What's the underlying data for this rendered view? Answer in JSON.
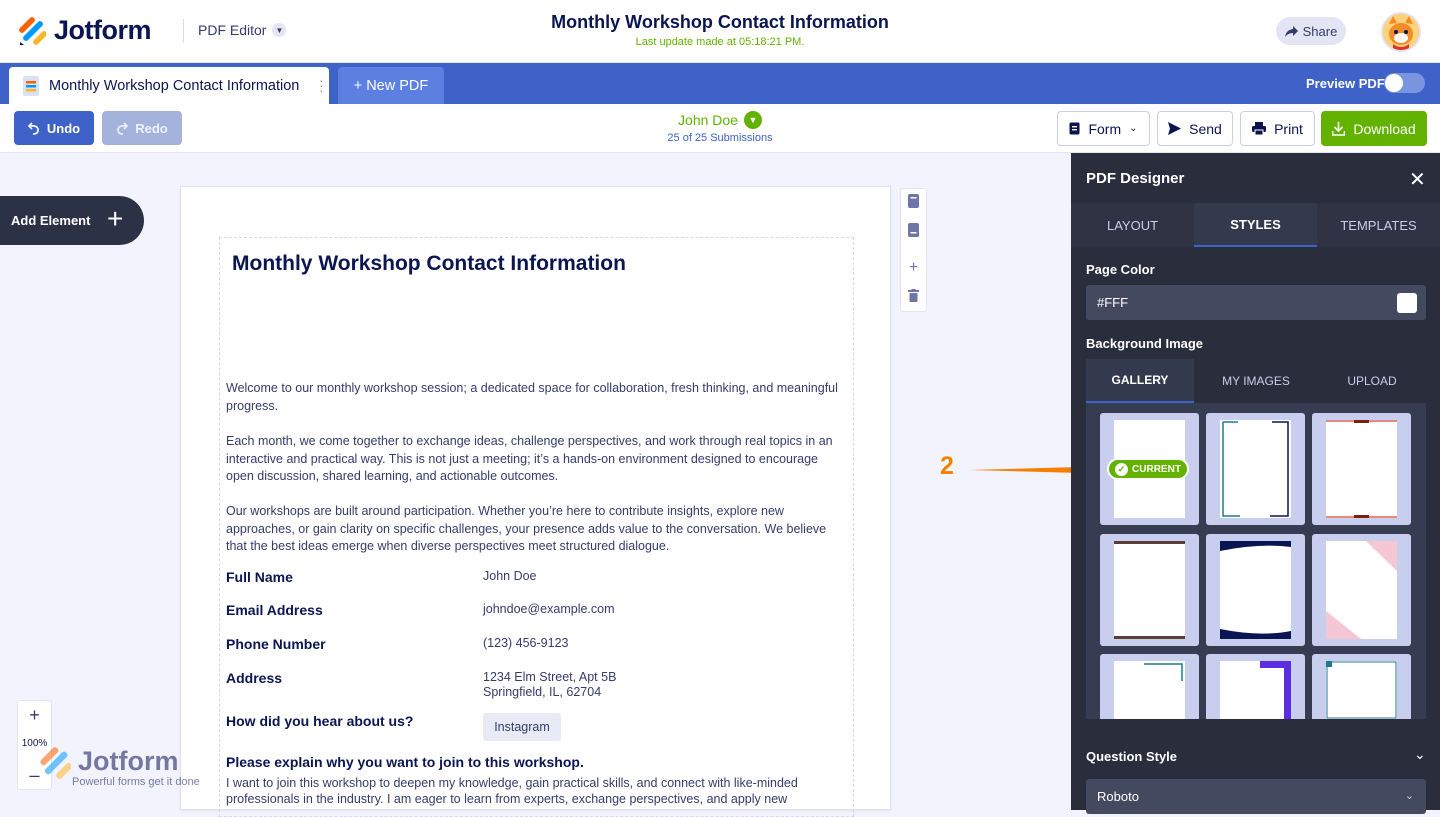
{
  "header": {
    "brand": "Jotform",
    "editor_label": "PDF Editor",
    "title": "Monthly Workshop Contact Information",
    "last_update": "Last update made at 05:18:21 PM.",
    "share_label": "Share"
  },
  "tabs": {
    "active_tab": "Monthly Workshop Contact Information",
    "new_pdf": "+ New PDF",
    "preview_label": "Preview PDF",
    "preview_on": false
  },
  "toolbar": {
    "undo": "Undo",
    "redo": "Redo",
    "submitter": "John Doe",
    "submissions": "25 of 25 Submissions",
    "form": "Form",
    "send": "Send",
    "print": "Print",
    "download": "Download"
  },
  "left": {
    "add_element": "Add Element",
    "zoom": "100%",
    "watermark_brand": "Jotform",
    "watermark_tagline": "Powerful forms get it done"
  },
  "document": {
    "title": "Monthly Workshop Contact Information",
    "paragraphs": [
      "Welcome to our monthly workshop session; a dedicated space for collaboration, fresh thinking, and meaningful progress.",
      "Each month, we come together to exchange ideas, challenge perspectives, and work through real topics in an interactive and practical way. This is not just a meeting; it’s a hands-on environment designed to encourage open discussion, shared learning, and actionable outcomes.",
      "Our workshops are built around participation. Whether you’re here to contribute insights, explore new approaches, or gain clarity on specific challenges, your presence adds value to the conversation. We believe that the best ideas emerge when diverse perspectives meet structured dialogue."
    ],
    "fields": [
      {
        "label": "Full Name",
        "value": "John Doe"
      },
      {
        "label": "Email Address",
        "value": "johndoe@example.com"
      },
      {
        "label": "Phone Number",
        "value": "(123) 456-9123"
      },
      {
        "label": "Address",
        "value": "1234 Elm Street, Apt 5B",
        "value2": "Springfield, IL, 62704"
      },
      {
        "label": "How did you hear about us?",
        "value": "Instagram"
      }
    ],
    "question": "Please explain why you want to join to this workshop.",
    "answer": "I want to join this workshop to deepen my knowledge, gain practical skills, and connect with like-minded professionals in the industry. I am eager to learn from experts, exchange perspectives, and apply new"
  },
  "annotation": {
    "number": "2"
  },
  "panel": {
    "title": "PDF Designer",
    "tabs": [
      "LAYOUT",
      "STYLES",
      "TEMPLATES"
    ],
    "active_tab": "STYLES",
    "page_color_label": "Page Color",
    "page_color_value": "#FFF",
    "bg_image_label": "Background Image",
    "bg_tabs": [
      "GALLERY",
      "MY IMAGES",
      "UPLOAD"
    ],
    "active_bg_tab": "GALLERY",
    "current_label": "CURRENT",
    "question_style_label": "Question Style",
    "font_value": "Roboto"
  },
  "colors": {
    "primary": "#3e62c8",
    "success": "#64b200",
    "navy": "#0a1551",
    "panel": "#292d3c",
    "annotation": "#f77f00"
  }
}
